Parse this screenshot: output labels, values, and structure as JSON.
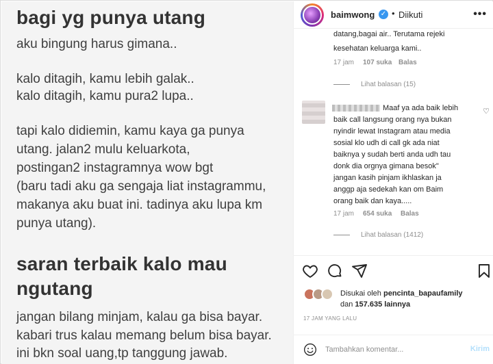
{
  "image": {
    "lines": [
      {
        "text": "bagi yg punya utang",
        "heading": true
      },
      {
        "text": "aku bingung harus gimana..",
        "heading": false
      },
      {
        "text": "kalo ditagih, kamu lebih galak..",
        "heading": false
      },
      {
        "text": "kalo ditagih, kamu pura2 lupa..",
        "heading": false
      },
      {
        "text": "tapi kalo didiemin, kamu kaya ga punya",
        "heading": false
      },
      {
        "text": "utang. jalan2 mulu keluarkota,",
        "heading": false
      },
      {
        "text": "postingan2 instagramnya wow bgt",
        "heading": false
      },
      {
        "text": "(baru tadi aku ga sengaja liat instagrammu,",
        "heading": false
      },
      {
        "text": "makanya aku buat ini. tadinya aku lupa km",
        "heading": false
      },
      {
        "text": "punya utang).",
        "heading": false
      },
      {
        "text": "saran terbaik kalo mau",
        "heading": true
      },
      {
        "text": "ngutang",
        "heading": true
      },
      {
        "text": "jangan bilang minjam, kalau ga bisa bayar.",
        "heading": false
      },
      {
        "text": "kabari trus kalau memang belum bisa bayar.",
        "heading": false
      },
      {
        "text": "ini bkn soal uang,tp tanggung jawab.",
        "heading": false
      }
    ]
  },
  "header": {
    "username": "baimwong",
    "separator": "•",
    "follow_state": "Diikuti",
    "more": "•••"
  },
  "comment1": {
    "lines": [
      "datang,bagai air..  Terutama rejeki",
      "kesehatan keluarga kami.."
    ],
    "time": "17 jam",
    "likes": "107 suka",
    "reply": "Balas",
    "view_replies": "Lihat balasan (15)"
  },
  "comment2": {
    "lines": [
      "Maaf ya ada baik lebih",
      "baik call langsung orang nya bukan",
      "nyindir lewat Instagram atau media",
      "sosial klo udh di call gk ada niat",
      "baiknya y sudah berti anda udh tau",
      "donk dia orgnya gimana besok\"",
      "jangan kasih pinjam ikhlaskan ja",
      "anggp aja sedekah kan om Baim",
      "orang baik dan kaya....."
    ],
    "time": "17 jam",
    "likes": "654 suka",
    "reply": "Balas",
    "view_replies": "Lihat balasan (1412)"
  },
  "likes": {
    "prefix": "Disukai oleh ",
    "user": "pencinta_bapaufamily",
    "and": "dan ",
    "count": "157.635 lainnya"
  },
  "timestamp": "17 JAM YANG LALU",
  "comment_box": {
    "placeholder": "Tambahkan komentar...",
    "post_label": "Kirim"
  }
}
